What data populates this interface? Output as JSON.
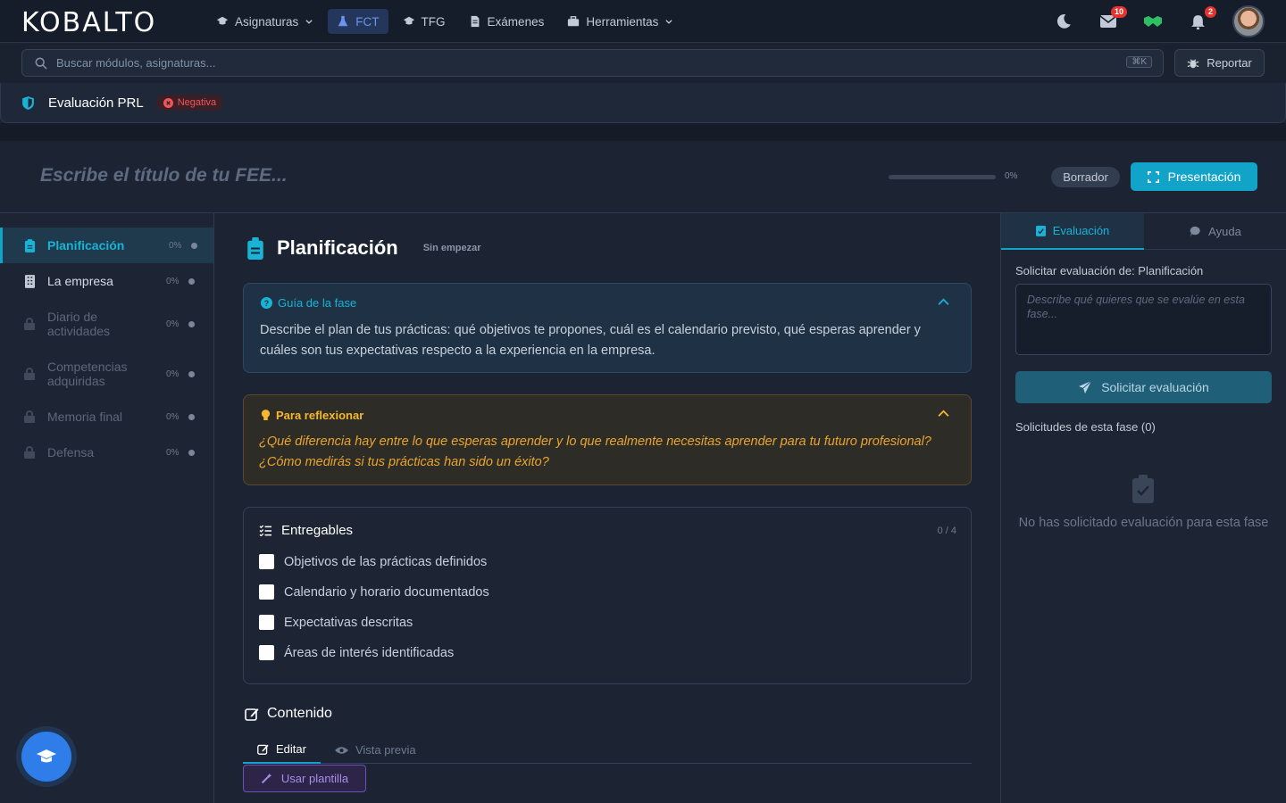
{
  "app": {
    "logo": "KOBALTO"
  },
  "nav": {
    "items": [
      {
        "label": "Asignaturas",
        "icon": "graduation-cap-icon",
        "dropdown": true
      },
      {
        "label": "FCT",
        "icon": "flask-icon",
        "active": true
      },
      {
        "label": "TFG",
        "icon": "graduation-cap-icon"
      },
      {
        "label": "Exámenes",
        "icon": "document-icon"
      },
      {
        "label": "Herramientas",
        "icon": "toolbox-icon",
        "dropdown": true
      }
    ],
    "mail_badge": "10",
    "notif_badge": "2"
  },
  "search": {
    "placeholder": "Buscar módulos, asignaturas...",
    "shortcut": "⌘K"
  },
  "report": {
    "label": "Reportar"
  },
  "module": {
    "title": "Evaluación PRL",
    "status": "Negativa"
  },
  "fee": {
    "title_placeholder": "Escribe el título de tu FEE...",
    "progress": "0%",
    "progress_value": 0,
    "state": "Borrador",
    "present_label": "Presentación"
  },
  "sidebar": {
    "items": [
      {
        "label": "Planificación",
        "pct": "0%",
        "icon": "clipboard-icon",
        "active": true
      },
      {
        "label": "La empresa",
        "pct": "0%",
        "icon": "building-icon"
      },
      {
        "label": "Diario de actividades",
        "pct": "0%",
        "icon": "lock-icon",
        "locked": true
      },
      {
        "label": "Competencias adquiridas",
        "pct": "0%",
        "icon": "lock-icon",
        "locked": true
      },
      {
        "label": "Memoria final",
        "pct": "0%",
        "icon": "lock-icon",
        "locked": true
      },
      {
        "label": "Defensa",
        "pct": "0%",
        "icon": "lock-icon",
        "locked": true
      }
    ]
  },
  "phase": {
    "title": "Planificación",
    "status": "Sin empezar",
    "guide_title": "Guía de la fase",
    "guide_body": "Describe el plan de tus prácticas: qué objetivos te propones, cuál es el calendario previsto, qué esperas aprender y cuáles son tus expectativas respecto a la experiencia en la empresa.",
    "reflect_title": "Para reflexionar",
    "reflect_body": "¿Qué diferencia hay entre lo que esperas aprender y lo que realmente necesitas aprender para tu futuro profesional? ¿Cómo medirás si tus prácticas han sido un éxito?",
    "deliverables_title": "Entregables",
    "deliverables_count": "0 / 4",
    "deliverables": [
      "Objetivos de las prácticas definidos",
      "Calendario y horario documentados",
      "Expectativas descritas",
      "Áreas de interés identificadas"
    ],
    "content_title": "Contenido",
    "tab_edit": "Editar",
    "tab_preview": "Vista previa",
    "template_label": "Usar plantilla"
  },
  "right": {
    "tab_eval": "Evaluación",
    "tab_help": "Ayuda",
    "request_label": "Solicitar evaluación de: Planificación",
    "textarea_placeholder": "Describe qué quieres que se evalúe en esta fase...",
    "request_button": "Solicitar evaluación",
    "requests_title": "Solicitudes de esta fase (0)",
    "empty_text": "No has solicitado evaluación para esta fase"
  },
  "colors": {
    "accent": "#12a3c9",
    "danger": "#e5342f",
    "warning": "#f5b82e",
    "purple": "#6c4fb8"
  }
}
